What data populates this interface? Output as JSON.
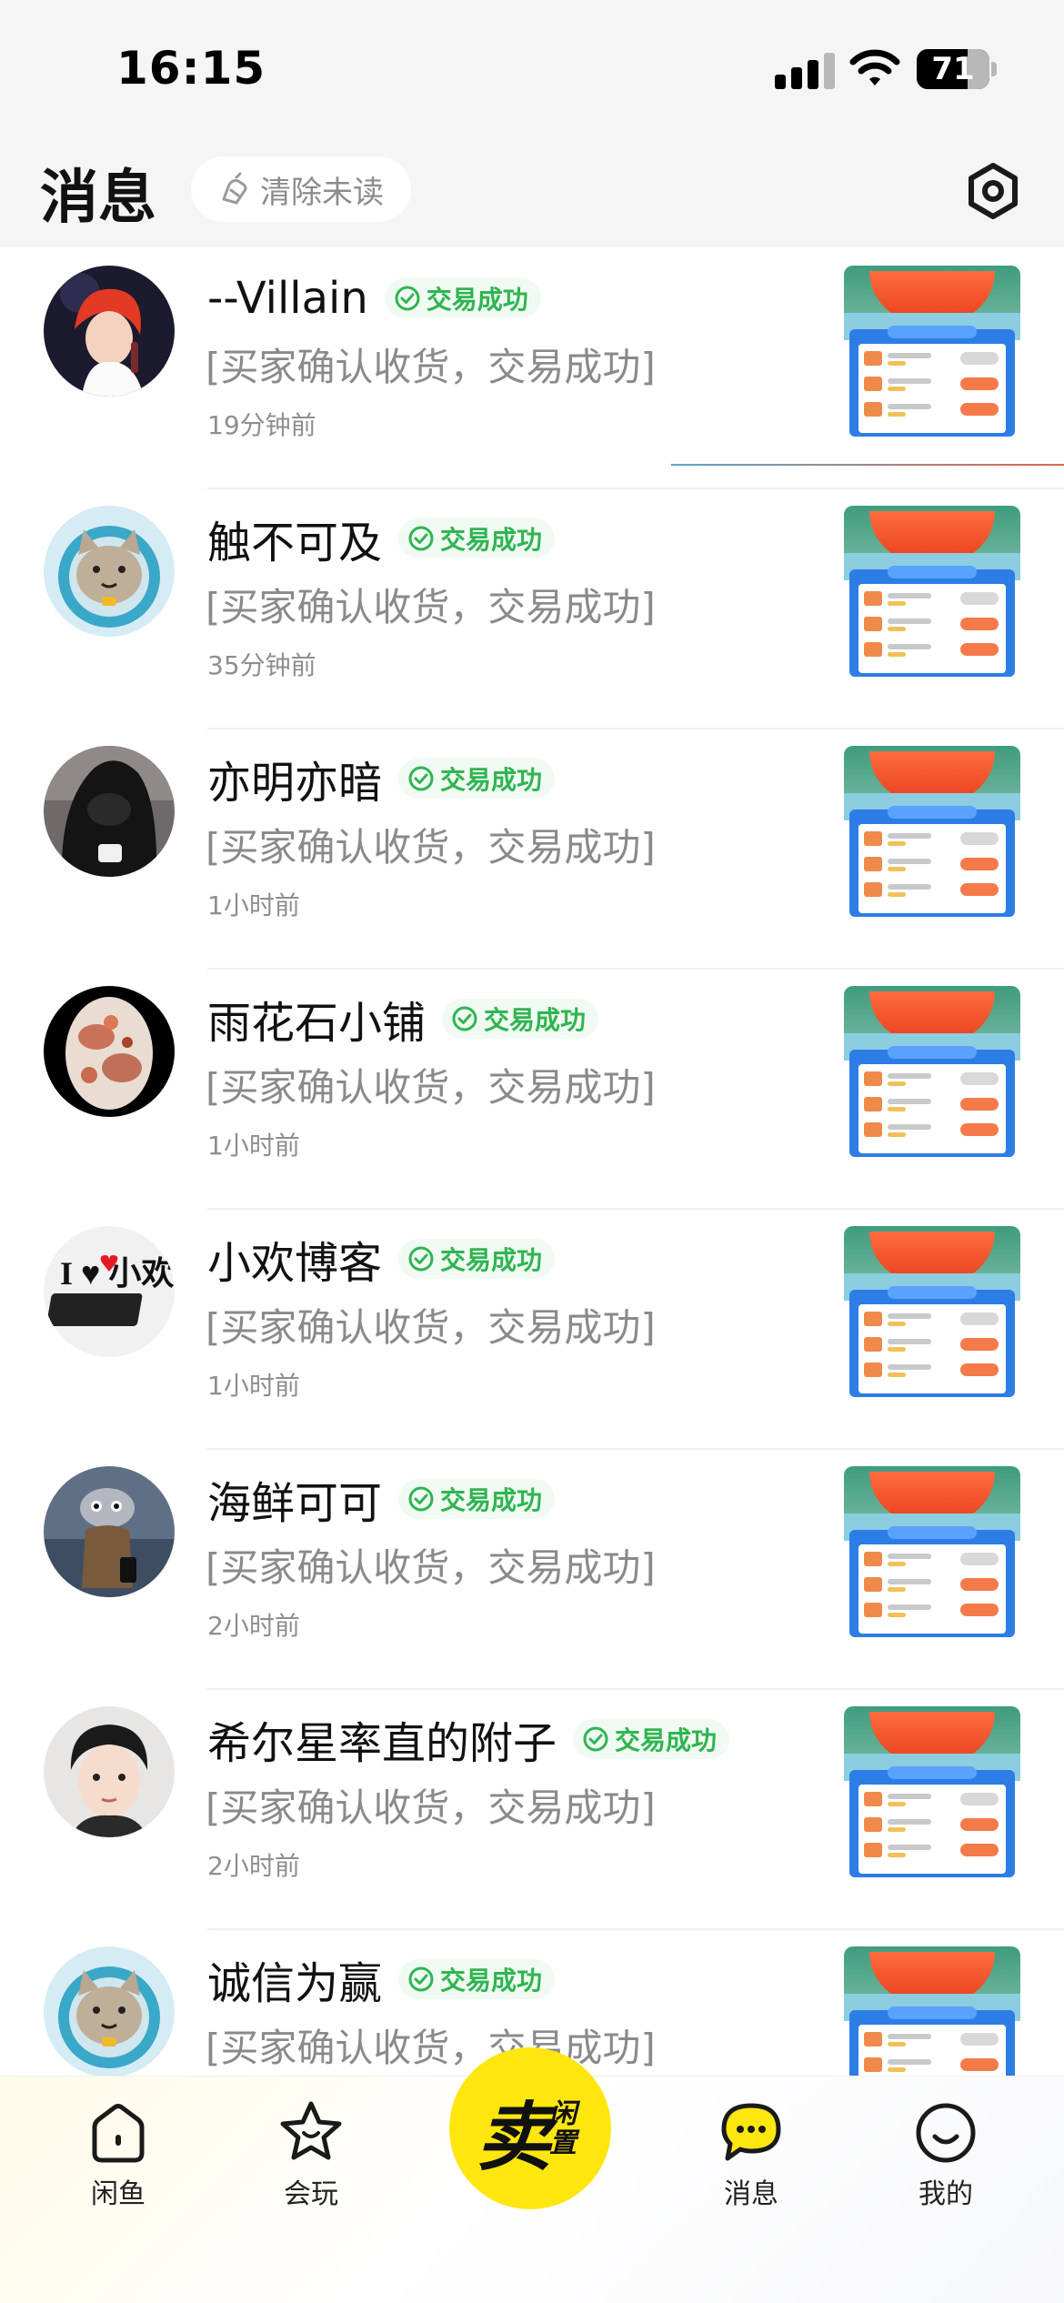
{
  "status_bar": {
    "time": "16:15",
    "battery": "71"
  },
  "header": {
    "title": "消息",
    "clear_unread_label": "清除未读"
  },
  "messages": [
    {
      "name": "--Villain",
      "badge": "交易成功",
      "preview": "[买家确认收货，交易成功]",
      "time": "19分钟前",
      "avatar": "anime-red-hair"
    },
    {
      "name": "触不可及",
      "badge": "交易成功",
      "preview": "[买家确认收货，交易成功]",
      "time": "35分钟前",
      "avatar": "cat-astronaut"
    },
    {
      "name": "亦明亦暗",
      "badge": "交易成功",
      "preview": "[买家确认收货，交易成功]",
      "time": "1小时前",
      "avatar": "hooded-figure"
    },
    {
      "name": "雨花石小铺",
      "badge": "交易成功",
      "preview": "[买家确认收货，交易成功]",
      "time": "1小时前",
      "avatar": "agate-stone"
    },
    {
      "name": "小欢博客",
      "badge": "交易成功",
      "preview": "[买家确认收货，交易成功]",
      "time": "1小时前",
      "avatar": "i-love-xiaohuan",
      "avatar_text": "I ♥ 小欢"
    },
    {
      "name": "海鲜可可",
      "badge": "交易成功",
      "preview": "[买家确认收货，交易成功]",
      "time": "2小时前",
      "avatar": "cartoon-squid"
    },
    {
      "name": "希尔星率直的附子",
      "badge": "交易成功",
      "preview": "[买家确认收货，交易成功]",
      "time": "2小时前",
      "avatar": "boy-portrait"
    },
    {
      "name": "诚信为赢",
      "badge": "交易成功",
      "preview": "[买家确认收货，交易成功]",
      "time": "",
      "avatar": "cat-astronaut"
    }
  ],
  "tab_bar": {
    "items": [
      {
        "label": "闲鱼",
        "icon": "home-icon"
      },
      {
        "label": "会玩",
        "icon": "star-face-icon"
      },
      {
        "label": "消息",
        "icon": "chat-bubble-icon",
        "active": true
      },
      {
        "label": "我的",
        "icon": "smile-icon"
      }
    ],
    "sell": {
      "big": "卖",
      "small": "闲置"
    }
  },
  "colors": {
    "accent_yellow": "#ffe60f",
    "success_green": "#2fb551",
    "header_bg": "#f5f5f5"
  }
}
